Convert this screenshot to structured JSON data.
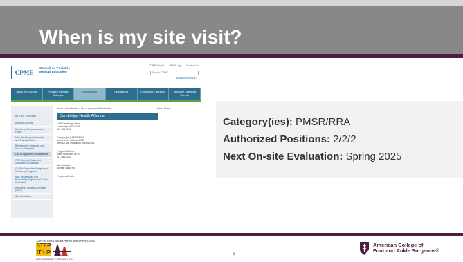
{
  "slide": {
    "title": "When is my site visit?",
    "page_number": "5"
  },
  "website": {
    "logo": "CPME",
    "org_name": "Council on Podiatric Medical Education",
    "top_links": [
      "CPME Portal",
      "PPMA.org",
      "Contact Us"
    ],
    "search_placeholder": "Search CPME",
    "advanced_search": "Advanced Search",
    "nav_items": [
      {
        "label": "About the Council",
        "active": false
      },
      {
        "label": "Podiatric Medical Colleges",
        "active": false
      },
      {
        "label": "Residencies",
        "active": true
      },
      {
        "label": "Fellowships",
        "active": false
      },
      {
        "label": "Continuing Education",
        "active": false
      },
      {
        "label": "Specialty Certifying Boards",
        "active": false
      }
    ],
    "sidebar_title": "In This Section",
    "sidebar_items": [
      {
        "label": "Approval Actions",
        "active": false
      },
      {
        "label": "Residency Documents and Forms",
        "active": false
      },
      {
        "label": "New Residency Documents and Training Dates",
        "active": false
      },
      {
        "label": "Residencies, Sponsors, and How to Document",
        "active": false
      },
      {
        "label": "List of Approved Residencies",
        "active": true
      },
      {
        "label": "RRC Meeting Dates and Submission Deadlines",
        "active": false
      },
      {
        "label": "On-Site Evaluation Assignment Residency Programs",
        "active": false
      },
      {
        "label": "New Residencies and Fellowships Eligible for On-Site Evaluation",
        "active": false
      },
      {
        "label": "Residency Review Committee (RRC)",
        "active": false
      },
      {
        "label": "Site Evaluators",
        "active": false
      }
    ],
    "breadcrumb": "Home » Residencies » List of Approved Residencies",
    "print_link": "Print · Share",
    "program_title": "Cambridge Health Alliance",
    "address": [
      "1493 Cambridge Street",
      "Cambridge, MA 02139",
      "617-665-1000"
    ],
    "category_block": [
      "Category(ies): PMSR/RRA",
      "Authorized Positions: 2/2/2",
      "Next On-site Evaluation: Spring 2025"
    ],
    "director_block": [
      "Program Director:",
      "Hans Schneider, DPM",
      "617-665-1080"
    ],
    "admin_block": [
      "Administrator:",
      "Annette Rand, MA"
    ],
    "website_link": "Program Website"
  },
  "info": {
    "category_label": "Category(ies):",
    "category_value": "PMSR/RRA",
    "positions_label": "Authorized Positions:",
    "positions_value": "2/2/2",
    "evaluation_label": "Next On-site Evaluation:",
    "evaluation_value": "Spring 2025"
  },
  "footer": {
    "conference_top": "ACFAS 2023 SCIENTIFIC CONFERENCE",
    "step_line1": "STEP",
    "step_line2": "IT UP",
    "conference_bottom": "LOS ANGELES • FEBRUARY 9-12",
    "org_line1": "American College of",
    "org_line2": "Foot and Ankle Surgeons®"
  },
  "colors": {
    "title_band": "#888888",
    "accent": "#4b1f3f",
    "site_nav": "#2e6d8e",
    "site_green": "#59a63a",
    "step_yellow": "#f3c200"
  }
}
